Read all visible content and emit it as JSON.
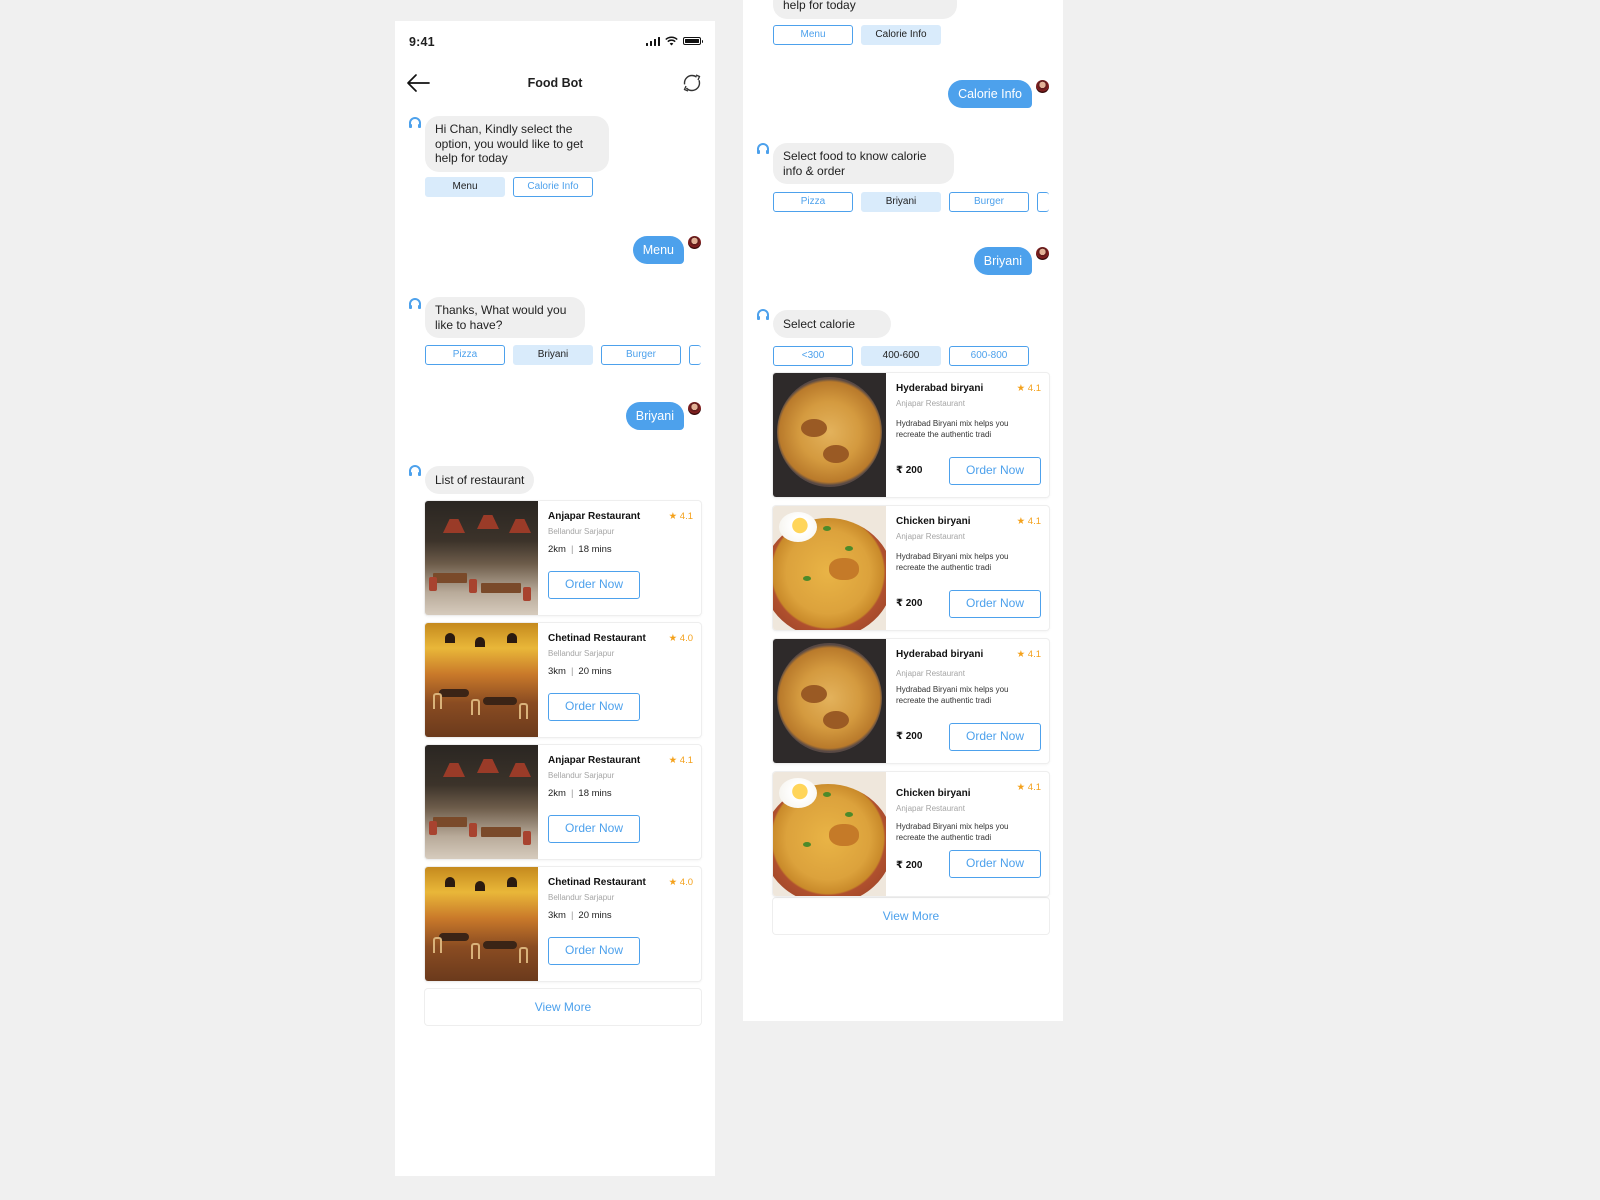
{
  "left_screen": {
    "status_time": "9:41",
    "nav_title": "Food Bot",
    "messages": {
      "bot_greeting": "Hi Chan, Kindly select the option, you would like to get help for today",
      "greeting_chips": [
        "Menu",
        "Calorie Info"
      ],
      "user_menu": "Menu",
      "bot_ask": "Thanks, What would you like to have?",
      "food_chips": [
        "Pizza",
        "Briyani",
        "Burger"
      ],
      "user_briyani": "Briyani",
      "bot_list": "List of restaurant"
    },
    "restaurants": [
      {
        "name": "Anjapar Restaurant",
        "rating": "★ 4.1",
        "location": "Bellandur Sarjapur",
        "distance": "2km",
        "time": "18 mins",
        "button": "Order Now"
      },
      {
        "name": "Chetinad Restaurant",
        "rating": "★ 4.0",
        "location": "Bellandur Sarjapur",
        "distance": "3km",
        "time": "20 mins",
        "button": "Order Now"
      },
      {
        "name": "Anjapar Restaurant",
        "rating": "★ 4.1",
        "location": "Bellandur Sarjapur",
        "distance": "2km",
        "time": "18 mins",
        "button": "Order Now"
      },
      {
        "name": "Chetinad Restaurant",
        "rating": "★ 4.0",
        "location": "Bellandur Sarjapur",
        "distance": "3km",
        "time": "20 mins",
        "button": "Order Now"
      }
    ],
    "view_more": "View More"
  },
  "right_screen": {
    "partial_bubble": "help for today",
    "top_chips": [
      "Menu",
      "Calorie Info"
    ],
    "user_calorie": "Calorie Info",
    "bot_select_food": "Select food to know calorie info & order",
    "food_chips": [
      "Pizza",
      "Briyani",
      "Burger"
    ],
    "user_briyani": "Briyani",
    "bot_select_calorie": "Select calorie",
    "calorie_chips": [
      "<300",
      "400-600",
      "600-800"
    ],
    "dishes": [
      {
        "name": "Hyderabad biryani",
        "rating": "★ 4.1",
        "restaurant": "Anjapar Restaurant",
        "desc": "Hydrabad Biryani mix helps you recreate the authentic tradi",
        "price": "₹ 200",
        "button": "Order Now"
      },
      {
        "name": "Chicken biryani",
        "rating": "★ 4.1",
        "restaurant": "Anjapar Restaurant",
        "desc": "Hydrabad Biryani mix helps you recreate the authentic tradi",
        "price": "₹ 200",
        "button": "Order Now"
      },
      {
        "name": "Hyderabad biryani",
        "rating": "★ 4.1",
        "restaurant": "Anjapar Restaurant",
        "desc": "Hydrabad Biryani mix helps you recreate the authentic tradi",
        "price": "₹ 200",
        "button": "Order Now"
      },
      {
        "name": "Chicken biryani",
        "rating": "★ 4.1",
        "restaurant": "Anjapar Restaurant",
        "desc": "Hydrabad Biryani mix helps you recreate the authentic tradi",
        "price": "₹ 200",
        "button": "Order Now"
      }
    ],
    "view_more": "View More"
  },
  "icons": {
    "back": "back-arrow-icon",
    "refresh": "refresh-icon",
    "bot": "bot-headset-icon",
    "avatar": "user-avatar",
    "signal": "cellular-signal-icon",
    "wifi": "wifi-icon",
    "battery": "battery-icon"
  },
  "colors": {
    "accent": "#4da1ec",
    "chip_selected": "#d9ebfb",
    "bubble_bot": "#efefef",
    "rating": "#f4a11b",
    "background": "#f0f0f0"
  }
}
